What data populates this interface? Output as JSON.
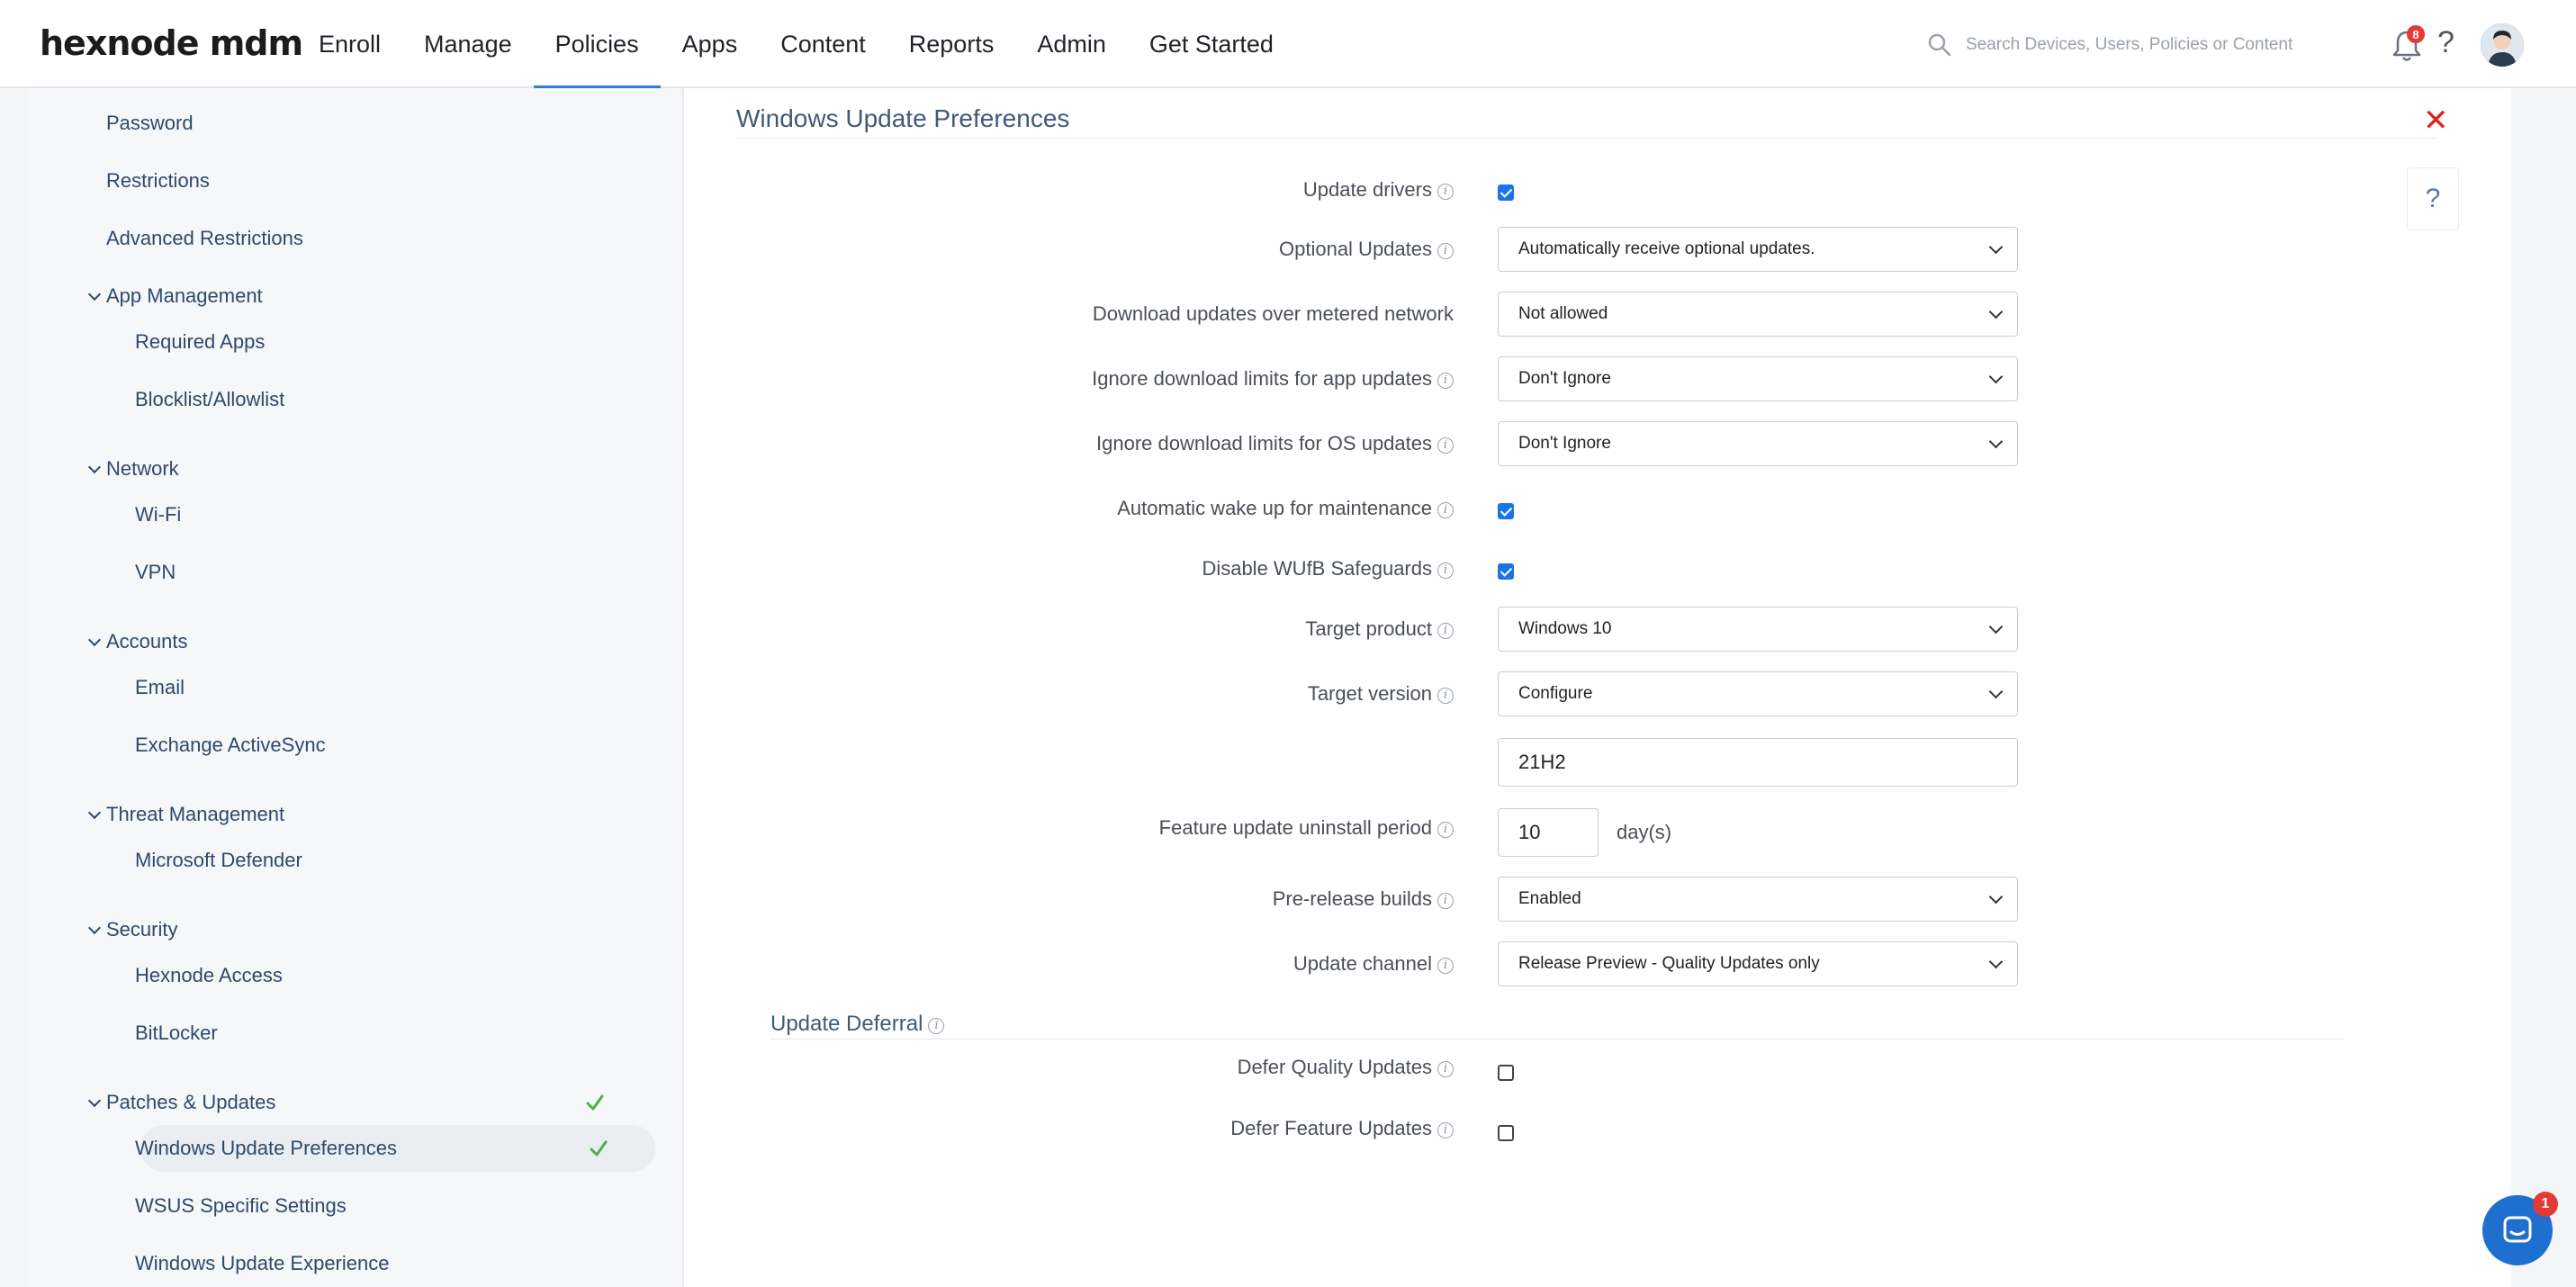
{
  "header": {
    "logo": "hexnode mdm",
    "nav": [
      "Enroll",
      "Manage",
      "Policies",
      "Apps",
      "Content",
      "Reports",
      "Admin",
      "Get Started"
    ],
    "active_nav": "Policies",
    "search_placeholder": "Search Devices, Users, Policies or Content",
    "notification_count": "8",
    "help": "?"
  },
  "sidebar": {
    "items": {
      "password": "Password",
      "restrictions": "Restrictions",
      "advanced_restrictions": "Advanced Restrictions",
      "app_management": "App Management",
      "required_apps": "Required Apps",
      "blocklist": "Blocklist/Allowlist",
      "network": "Network",
      "wifi": "Wi-Fi",
      "vpn": "VPN",
      "accounts": "Accounts",
      "email": "Email",
      "exchange": "Exchange ActiveSync",
      "threat": "Threat Management",
      "defender": "Microsoft Defender",
      "security": "Security",
      "hexnode_access": "Hexnode Access",
      "bitlocker": "BitLocker",
      "patches": "Patches & Updates",
      "windows_update_prefs": "Windows Update Preferences",
      "wsus": "WSUS Specific Settings",
      "windows_update_exp": "Windows Update Experience"
    }
  },
  "main": {
    "title": "Windows Update Preferences",
    "help_label": "?",
    "fields": {
      "update_drivers": {
        "label": "Update drivers",
        "checked": true
      },
      "optional_updates": {
        "label": "Optional Updates",
        "value": "Automatically receive optional updates."
      },
      "metered": {
        "label": "Download updates over metered network",
        "value": "Not allowed"
      },
      "ignore_app": {
        "label": "Ignore download limits for app updates",
        "value": "Don't Ignore"
      },
      "ignore_os": {
        "label": "Ignore download limits for OS updates",
        "value": "Don't Ignore"
      },
      "wake": {
        "label": "Automatic wake up for maintenance",
        "checked": true
      },
      "safeguards": {
        "label": "Disable WUfB Safeguards",
        "checked": true
      },
      "target_product": {
        "label": "Target product",
        "value": "Windows 10"
      },
      "target_version": {
        "label": "Target version",
        "value": "Configure",
        "version_value": "21H2"
      },
      "uninstall_period": {
        "label": "Feature update uninstall period",
        "value": "10",
        "unit": "day(s)"
      },
      "prerelease": {
        "label": "Pre-release builds",
        "value": "Enabled"
      },
      "channel": {
        "label": "Update channel",
        "value": "Release Preview - Quality Updates only"
      }
    },
    "deferral": {
      "title": "Update Deferral",
      "defer_quality": {
        "label": "Defer Quality Updates",
        "checked": false
      },
      "defer_feature": {
        "label": "Defer Feature Updates",
        "checked": false
      }
    }
  },
  "chat": {
    "badge": "1"
  },
  "colors": {
    "accent": "#2f7fd8",
    "close": "#e02020",
    "check_green": "#4caf50"
  }
}
